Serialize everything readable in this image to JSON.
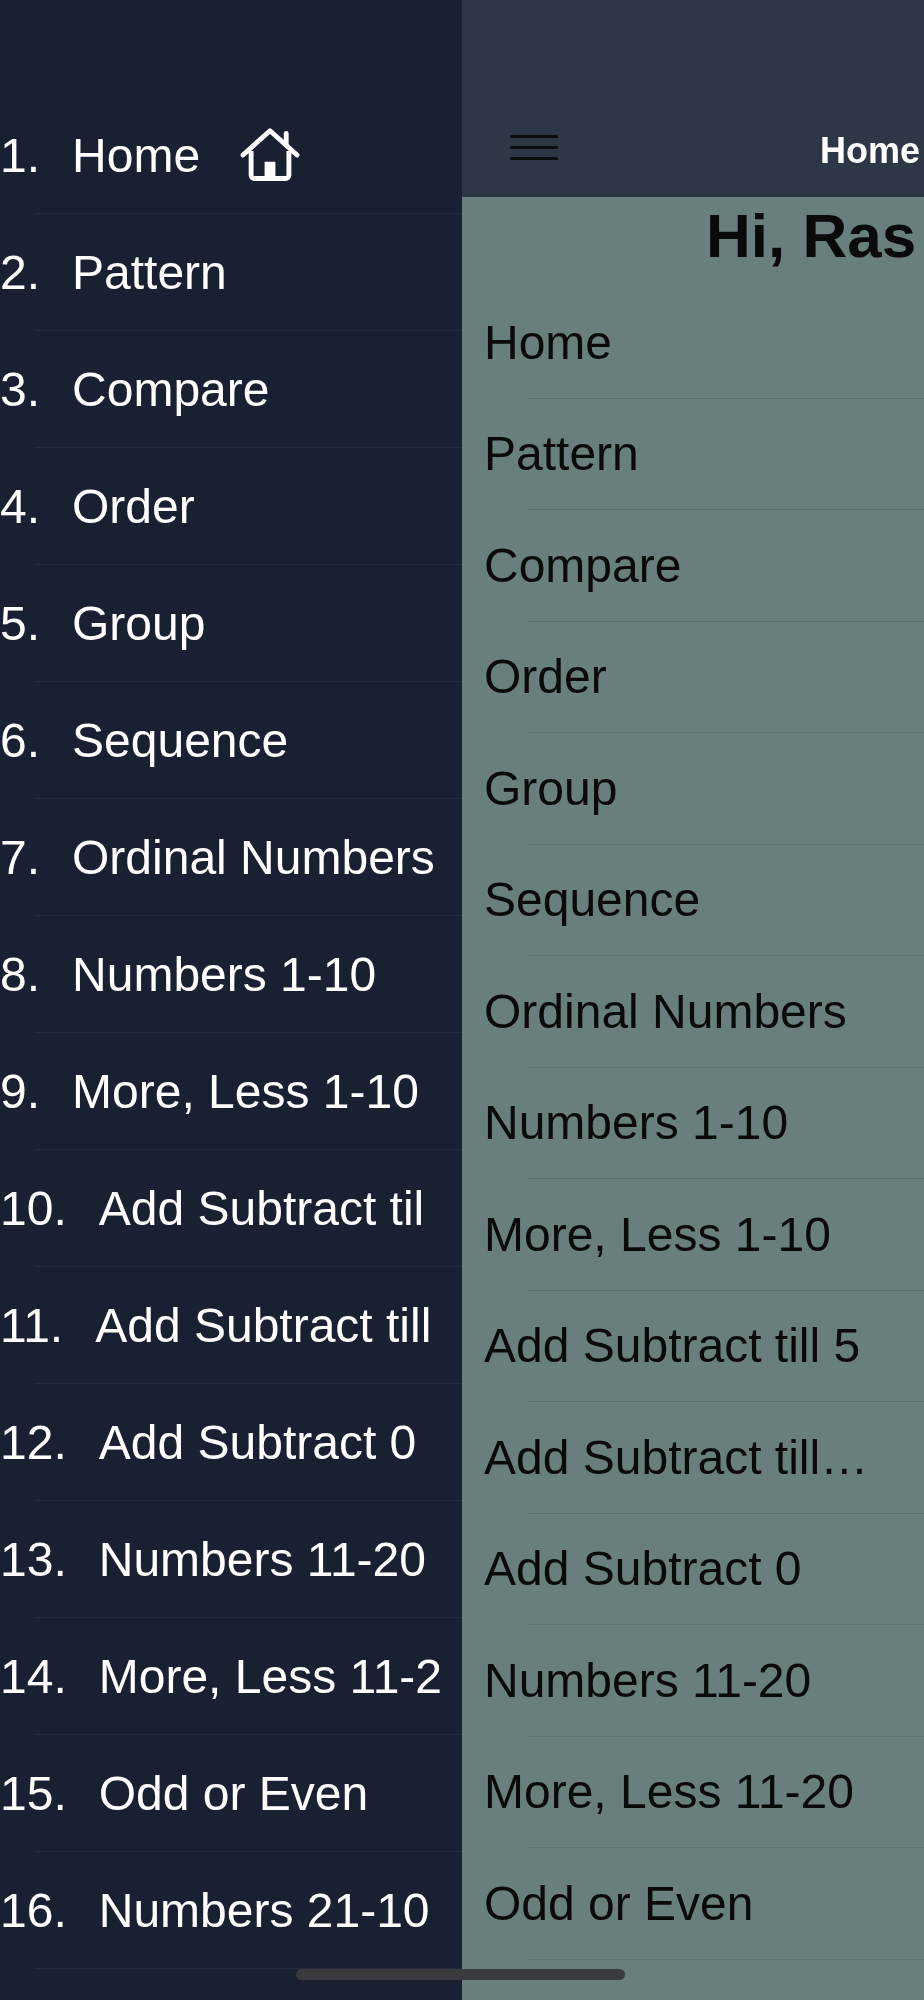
{
  "sidebar": {
    "items": [
      {
        "number": "1.",
        "label": "Home",
        "kind": "with_icon"
      },
      {
        "number": "2.",
        "label": "Pattern",
        "kind": "plain"
      },
      {
        "number": "3.",
        "label": "Compare",
        "kind": "plain"
      },
      {
        "number": "4.",
        "label": "Order",
        "kind": "plain"
      },
      {
        "number": "5.",
        "label": "Group",
        "kind": "plain"
      },
      {
        "number": "6.",
        "label": "Sequence",
        "kind": "plain"
      },
      {
        "number": "7.",
        "label": "Ordinal Numbers",
        "kind": "plain"
      },
      {
        "number": "8.",
        "label": "Numbers 1-10",
        "kind": "plain"
      },
      {
        "number": "9.",
        "label": "More, Less 1-10",
        "kind": "plain"
      },
      {
        "number": "10.",
        "label": "Add Subtract til",
        "kind": "plain"
      },
      {
        "number": "11.",
        "label": "Add Subtract till",
        "kind": "plain"
      },
      {
        "number": "12.",
        "label": "Add Subtract 0",
        "kind": "plain"
      },
      {
        "number": "13.",
        "label": "Numbers 11-20",
        "kind": "plain"
      },
      {
        "number": "14.",
        "label": "More, Less 11-2",
        "kind": "plain"
      },
      {
        "number": "15.",
        "label": "Odd or Even",
        "kind": "plain"
      },
      {
        "number": "16.",
        "label": "Numbers 21-10",
        "kind": "plain"
      }
    ]
  },
  "header": {
    "title": "Home"
  },
  "greeting": "Hi, Ras",
  "list": {
    "items": [
      "Home",
      "Pattern",
      "Compare",
      "Order",
      "Group",
      "Sequence",
      "Ordinal Numbers",
      "Numbers 1-10",
      "More, Less 1-10",
      "Add Subtract till 5",
      "Add Subtract till…",
      "Add Subtract 0",
      "Numbers 11-20",
      "More, Less 11-20",
      "Odd or Even"
    ]
  }
}
